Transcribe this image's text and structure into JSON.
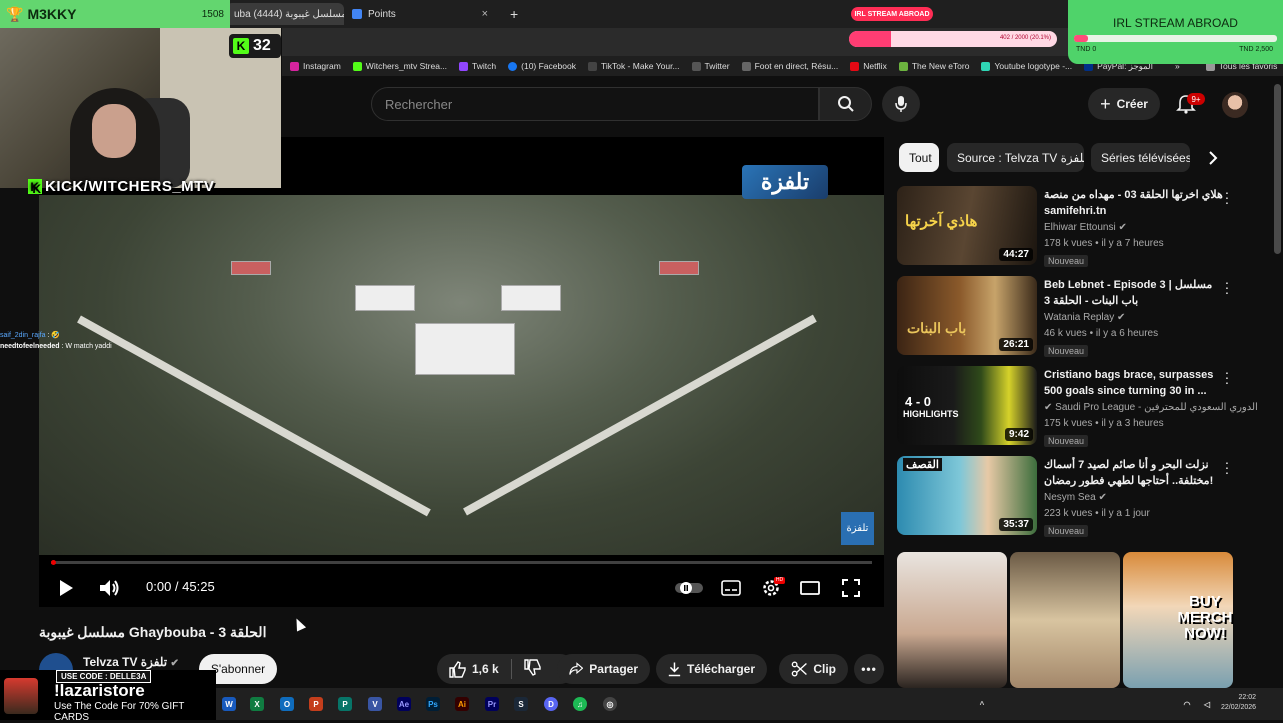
{
  "overlay": {
    "streamer_name": "M3KKY",
    "streamer_count": "1508",
    "kick_viewers": "32",
    "kick_handle": "KICK/WITCHERS_MTV",
    "irl_pill": "IRL STREAM ABROAD",
    "irl_bar_text": "402 / 2000 (20.1%)",
    "irl_bar_fraction": 0.2,
    "irl_goal_title": "IRL STREAM ABROAD",
    "irl_goal_low": "TND 0",
    "irl_goal_high": "TND 2,500",
    "irl_goal_fraction": 0.07,
    "chat": [
      {
        "user": "saif_2din_rajfa",
        "msg": ": 🤣"
      },
      {
        "user": "needtofeelneeded",
        "msg": ": W match yaddi"
      }
    ],
    "promo": {
      "code": "USE CODE : DELLE3A",
      "name": "!lazaristore",
      "sub": "Use The Code For 70% GIFT CARDS"
    },
    "merch": "BUY MERCH NOW!"
  },
  "browser": {
    "tabs": [
      {
        "label": "uba مسلسل غيبوبة (4444)",
        "active": true
      },
      {
        "label": "Points",
        "active": false
      }
    ],
    "new_tab": "+",
    "bookmarks": [
      {
        "label": "Instagram",
        "color": "#d6249f"
      },
      {
        "label": "Witchers_mtv Strea...",
        "color": "#53fc18"
      },
      {
        "label": "Twitch",
        "color": "#9146ff"
      },
      {
        "label": "(10) Facebook",
        "color": "#1877f2"
      },
      {
        "label": "TikTok - Make Your...",
        "color": "#111111"
      },
      {
        "label": "Twitter",
        "color": "#000000"
      },
      {
        "label": "Foot en direct, Résu...",
        "color": "#222222"
      },
      {
        "label": "Netflix",
        "color": "#e50914"
      },
      {
        "label": "The New eToro",
        "color": "#6cb33f"
      },
      {
        "label": "Youtube logotype -...",
        "color": "#2fd6b5"
      },
      {
        "label": "PayPal: الموجز",
        "color": "#003087"
      }
    ],
    "bookmarks_more": "»",
    "all_favorites": "Tous les favoris"
  },
  "youtube": {
    "search_placeholder": "Rechercher",
    "create_label": "Créer",
    "notif_count": "9+",
    "video": {
      "watermark_top": "تلفزة",
      "watermark_bottom": "تلفزة",
      "time": "0:00 / 45:25",
      "progress_fraction": 0.0,
      "title": "مسلسل غيبوبة Ghaybouba - الحلقة 3",
      "channel": "Telvza TV تلفزة",
      "subscribe": "S'abonner",
      "likes": "1,6 k",
      "share": "Partager",
      "download": "Télécharger",
      "clip": "Clip"
    },
    "chips": [
      "Tout",
      "Source : Telvza TV تلفزة",
      "Séries télévisées"
    ],
    "recommendations": [
      {
        "title": "هلاي اخرتها الحلقة 03 - مهداه من منصة samifehri.tn",
        "channel": "Elhiwar Ettounsi",
        "meta": "178 k vues • il y a 7 heures",
        "duration": "44:27",
        "badge": "Nouveau",
        "thumb_text": "هاذي آخرتها"
      },
      {
        "title": "Beb Lebnet - Episode 3 | مسلسل باب البنات - الحلقة 3",
        "channel": "Watania Replay",
        "meta": "46 k vues • il y a 6 heures",
        "duration": "26:21",
        "badge": "Nouveau",
        "thumb_text": "باب البنات"
      },
      {
        "title": "Cristiano bags brace, surpasses 500 goals since turning 30 in ...",
        "channel": "Saudi Pro League - الدوري السعودي للمحترفين",
        "meta": "175 k vues • il y a 3 heures",
        "duration": "9:42",
        "badge": "Nouveau",
        "thumb_text": "HIGHLIGHTS",
        "thumb_score": "4 - 0"
      },
      {
        "title": "نزلت البحر و أنا صائم لصيد 7 أسماك مختلفة.. أحتاجها لطهي فطور رمضان!",
        "channel": "Nesym Sea",
        "meta": "223 k vues • il y a 1 jour",
        "duration": "35:37",
        "badge": "Nouveau",
        "thumb_text": "القصف"
      }
    ]
  },
  "taskbar": {
    "clock_time": "22:02",
    "clock_date": "22/02/2026"
  }
}
